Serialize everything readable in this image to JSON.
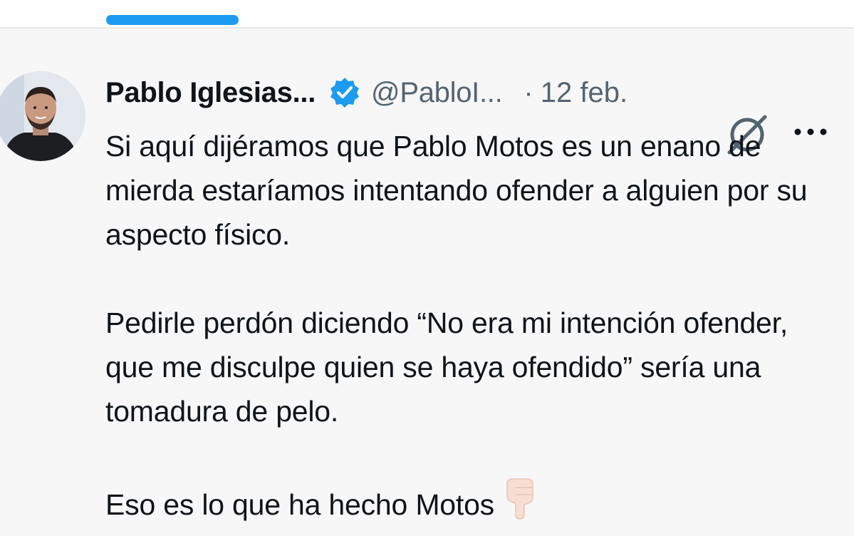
{
  "tabs": {
    "active_indicator_color": "#1d9bf0"
  },
  "tweet": {
    "author": {
      "display_name": "Pablo Iglesias...",
      "handle": "@PabloI...",
      "verified_icon": "verified-badge-icon",
      "verified_color": "#1d9bf0"
    },
    "separator": "·",
    "date": "12 feb.",
    "actions": {
      "grok_icon": "grok-icon",
      "more_icon": "more-options-icon"
    },
    "paragraphs": [
      "Si aquí dijéramos que Pablo Motos es un enano de mierda estaríamos intentando ofender a alguien por su aspecto físico.",
      "Pedirle perdón diciendo “No era mi intención ofender, que me disculpe quien se haya ofendido” sería una tomadura de pelo.",
      "Eso es lo que ha hecho Motos"
    ],
    "trailing_emoji": "backhand-index-pointing-down-emoji"
  }
}
